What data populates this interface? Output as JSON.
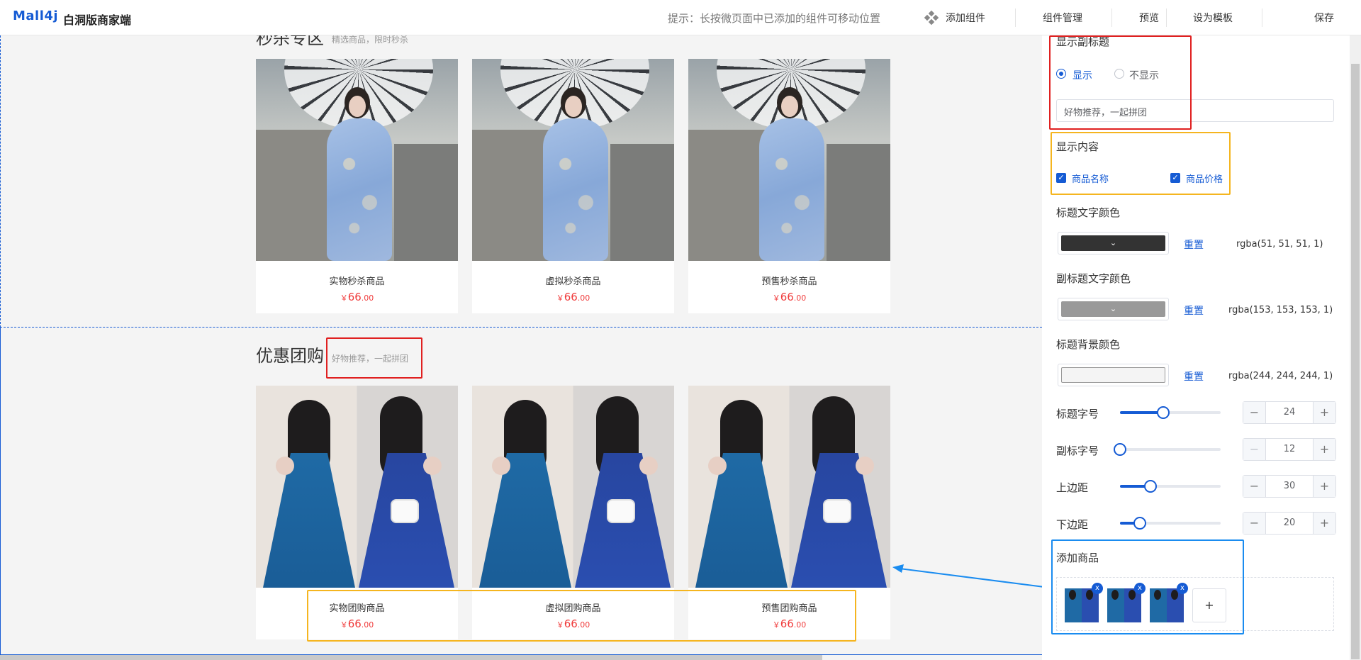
{
  "header": {
    "logo": "Mall4j",
    "logo_sub": "白洞版商家端",
    "tip": "提示：长按微页面中已添加的组件可移动位置",
    "nav": {
      "add_widget": "添加组件",
      "widget_manage": "组件管理",
      "preview": "预览",
      "set_template": "设为模板",
      "save": "保存"
    }
  },
  "canvas": {
    "seckill": {
      "title": "秒杀专区",
      "subtitle": "精选商品，限时秒杀",
      "items": [
        {
          "name": "实物秒杀商品",
          "currency": "￥",
          "price_int": "66",
          "price_dec": ".00"
        },
        {
          "name": "虚拟秒杀商品",
          "currency": "￥",
          "price_int": "66",
          "price_dec": ".00"
        },
        {
          "name": "预售秒杀商品",
          "currency": "￥",
          "price_int": "66",
          "price_dec": ".00"
        }
      ]
    },
    "group": {
      "title": "优惠团购",
      "subtitle": "好物推荐，一起拼团",
      "items": [
        {
          "name": "实物团购商品",
          "currency": "￥",
          "price_int": "66",
          "price_dec": ".00"
        },
        {
          "name": "虚拟团购商品",
          "currency": "￥",
          "price_int": "66",
          "price_dec": ".00"
        },
        {
          "name": "预售团购商品",
          "currency": "￥",
          "price_int": "66",
          "price_dec": ".00"
        }
      ]
    }
  },
  "panel": {
    "subtitle_section": {
      "label": "显示副标题",
      "show": "显示",
      "hide": "不显示",
      "selected": "显示",
      "input_value": "好物推荐，一起拼团"
    },
    "content_section": {
      "label": "显示内容",
      "goods_name": "商品名称",
      "goods_price": "商品价格"
    },
    "colors": [
      {
        "label": "标题文字颜色",
        "reset": "重置",
        "value": "rgba(51, 51, 51, 1)",
        "hex": "#333333"
      },
      {
        "label": "副标题文字颜色",
        "reset": "重置",
        "value": "rgba(153, 153, 153, 1)",
        "hex": "#999999"
      },
      {
        "label": "标题背景颜色",
        "reset": "重置",
        "value": "rgba(244, 244, 244, 1)",
        "hex": "#f4f4f4"
      }
    ],
    "sliders": [
      {
        "label": "标题字号",
        "value": "24",
        "minus": "−",
        "plus": "+",
        "fraction": 0.43
      },
      {
        "label": "副标字号",
        "value": "12",
        "minus": "−",
        "plus": "+",
        "fraction": 0.0
      },
      {
        "label": "上边距",
        "value": "30",
        "minus": "−",
        "plus": "+",
        "fraction": 0.3
      },
      {
        "label": "下边距",
        "value": "20",
        "minus": "−",
        "plus": "+",
        "fraction": 0.2
      }
    ],
    "goods_section": {
      "label": "添加商品",
      "remove": "x",
      "add": "+"
    }
  },
  "colors": {
    "primary": "#155bd4",
    "price": "#f03c3c",
    "annotation_red": "#e02020",
    "annotation_yellow": "#f5b51f",
    "annotation_blue": "#1a8cf0"
  }
}
